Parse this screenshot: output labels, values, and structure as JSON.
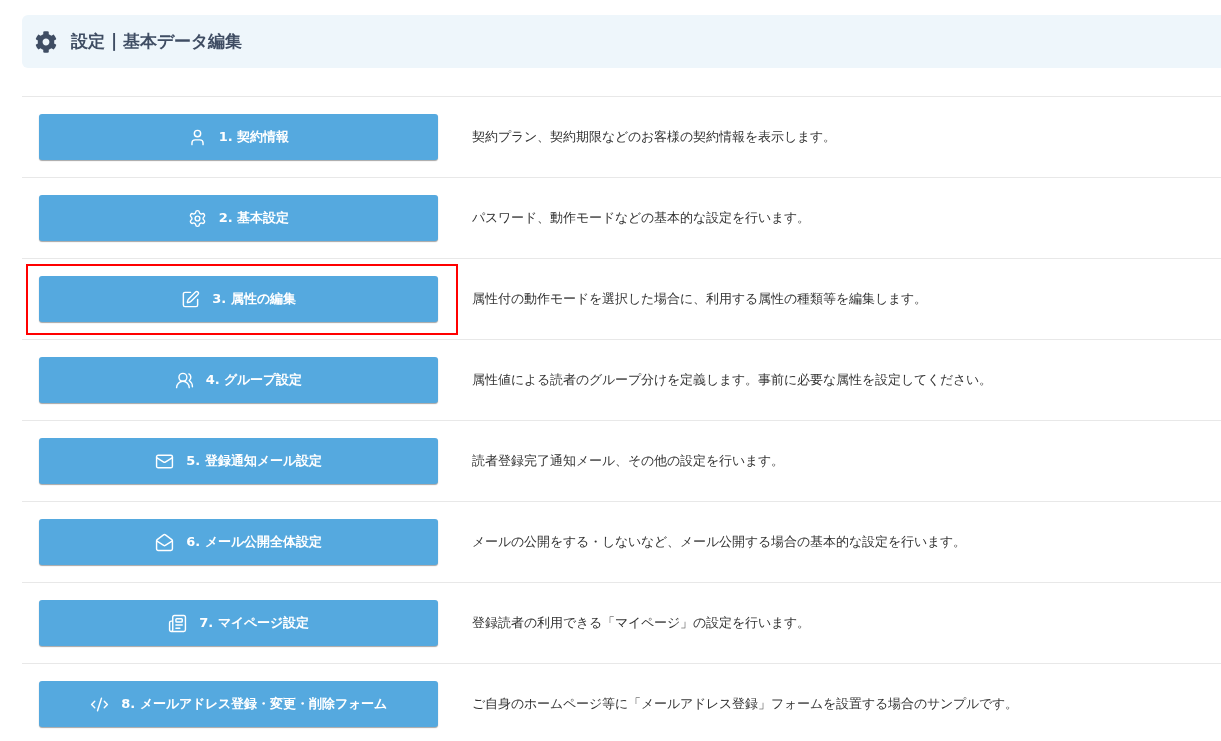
{
  "header": {
    "title": "設定 | 基本データ編集"
  },
  "items": [
    {
      "label": "1. 契約情報",
      "description": "契約プラン、契約期限などのお客様の契約情報を表示します。",
      "highlighted": false
    },
    {
      "label": "2. 基本設定",
      "description": "パスワード、動作モードなどの基本的な設定を行います。",
      "highlighted": false
    },
    {
      "label": "3. 属性の編集",
      "description": "属性付の動作モードを選択した場合に、利用する属性の種類等を編集します。",
      "highlighted": true
    },
    {
      "label": "4. グループ設定",
      "description": "属性値による読者のグループ分けを定義します。事前に必要な属性を設定してください。",
      "highlighted": false
    },
    {
      "label": "5. 登録通知メール設定",
      "description": "読者登録完了通知メール、その他の設定を行います。",
      "highlighted": false
    },
    {
      "label": "6. メール公開全体設定",
      "description": "メールの公開をする・しないなど、メール公開する場合の基本的な設定を行います。",
      "highlighted": false
    },
    {
      "label": "7. マイページ設定",
      "description": "登録読者の利用できる「マイページ」の設定を行います。",
      "highlighted": false
    },
    {
      "label": "8. メールアドレス登録・変更・削除フォーム",
      "description": "ご自身のホームページ等に「メールアドレス登録」フォームを設置する場合のサンプルです。",
      "highlighted": false
    }
  ]
}
